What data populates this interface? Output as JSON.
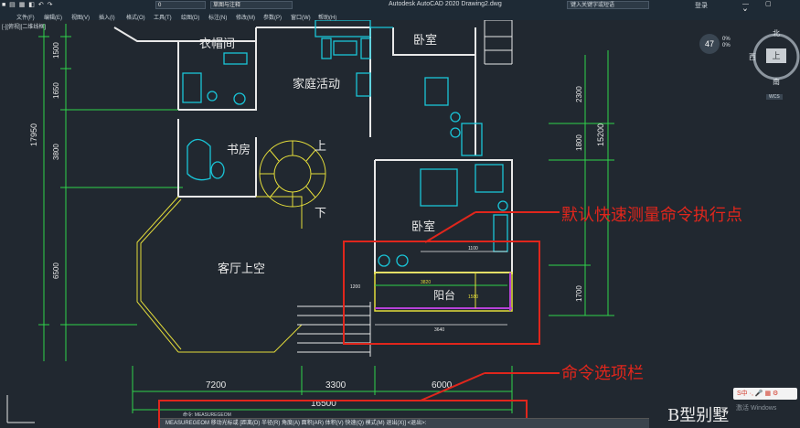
{
  "titlebar": {
    "app_title": "Autodesk AutoCAD 2020   Drawing2.dwg",
    "search_placeholder": "键入关键字或短语",
    "layer_value": "0",
    "workspace_value": "草图与注释",
    "user": "登录",
    "window_buttons": "— ▢ ✕"
  },
  "menubar": [
    "文件(F)",
    "编辑(E)",
    "视图(V)",
    "插入(I)",
    "格式(O)",
    "工具(T)",
    "绘图(D)",
    "标注(N)",
    "修改(M)",
    "参数(P)",
    "窗口(W)",
    "帮助(H)"
  ],
  "view_label": "[-][俯视][二维线框]",
  "rooms": {
    "cloakroom": "衣帽间",
    "family_activity": "家庭活动",
    "bedroom_top": "卧室",
    "study": "书房",
    "up": "上",
    "down": "下",
    "bedroom_mid": "卧室",
    "living_void": "客厅上空",
    "balcony": "阳台"
  },
  "dimensions": {
    "left_total": "17950",
    "left_1500": "1500",
    "left_1650": "1650",
    "left_3800": "3800",
    "left_6500": "6500",
    "right_2300": "2300",
    "right_1800": "1800",
    "right_15200": "15200",
    "right_1700": "1700",
    "bottom_7200": "7200",
    "bottom_3300": "3300",
    "bottom_6000": "6000",
    "bottom_total": "16500",
    "balcony_1100": "1100",
    "balcony_3820": "3820",
    "balcony_1580": "1580",
    "balcony_1200": "1200",
    "balcony_3640": "3640"
  },
  "annotations": {
    "measure_point": "默认快速测量命令执行点",
    "command_options": "命令选项栏"
  },
  "navigation": {
    "zoom_value": "47",
    "percent_top": "0%",
    "percent_bottom": "0%",
    "north": "北",
    "west": "西",
    "south": "南",
    "top_face": "上",
    "wcs": "WCS"
  },
  "command": {
    "hint": "命令: MEASUREGEOM",
    "line": "MEASUREGEOM 移动光标或 [距离(D) 半径(R) 角度(A) 面积(AR) 体积(V) 快速(Q) 模式(M) 退出(X)] <退出>:"
  },
  "ime": "S中 ·, 🎤 ▦ ⚙",
  "watermark": "B型别墅",
  "activate_windows": "激活 Windows",
  "colors": {
    "background": "#212830",
    "wall": "#e8e8e8",
    "cyan": "#19c5d8",
    "yellow": "#e3dc3a",
    "green": "#2fd44a",
    "red_annotation": "#e0261c",
    "magenta": "#b742d8"
  }
}
